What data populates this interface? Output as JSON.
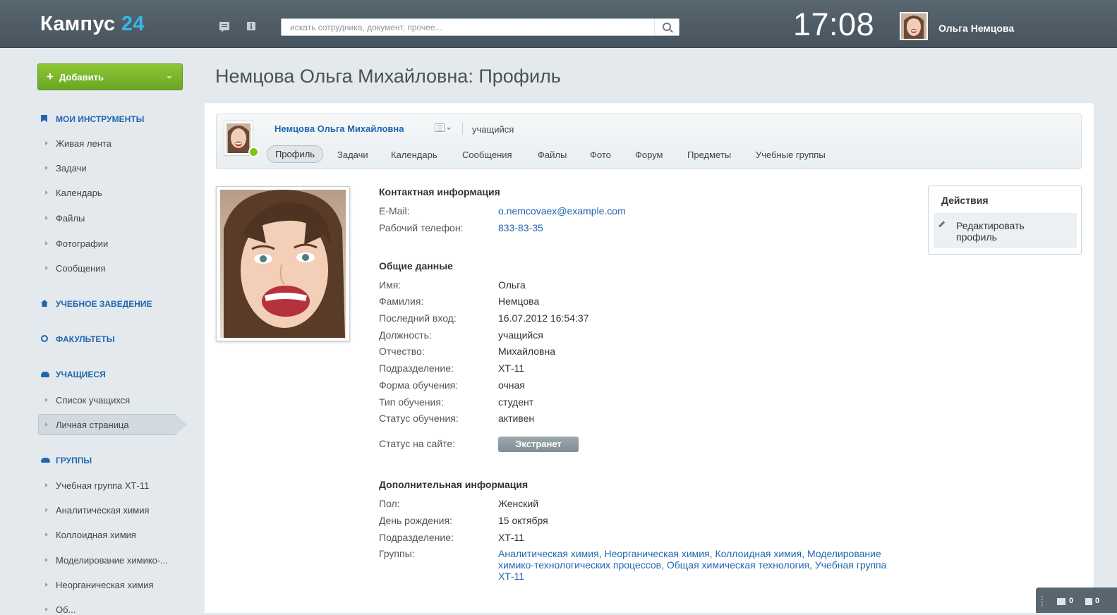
{
  "header": {
    "logo_text": "Кампус",
    "logo_num": "24",
    "search_placeholder": "искать сотрудника, документ, прочее...",
    "clock": "17:08",
    "user_name": "Ольга Немцова"
  },
  "sidebar": {
    "add_button": "Добавить",
    "sections": {
      "tools": "МОИ ИНСТРУМЕНТЫ",
      "school": "УЧЕБНОЕ ЗАВЕДЕНИЕ",
      "faculties": "ФАКУЛЬТЕТЫ",
      "students": "УЧАЩИЕСЯ",
      "groups": "ГРУППЫ"
    },
    "tools_items": [
      "Живая лента",
      "Задачи",
      "Календарь",
      "Файлы",
      "Фотографии",
      "Сообщения"
    ],
    "students_items": [
      "Список учащихся",
      "Личная страница"
    ],
    "groups_items": [
      "Учебная группа ХТ-11",
      "Аналитическая химия",
      "Коллоидная химия",
      "Моделирование химико-...",
      "Неорганическая химия",
      "Об..."
    ]
  },
  "page": {
    "title": "Немцова Ольга Михайловна: Профиль"
  },
  "profile_head": {
    "name": "Немцова Ольга Михайловна",
    "role": "учащийся",
    "tabs": [
      "Профиль",
      "Задачи",
      "Календарь",
      "Сообщения",
      "Файлы",
      "Фото",
      "Форум",
      "Предметы",
      "Учебные группы"
    ]
  },
  "contact": {
    "title": "Контактная информация",
    "email_label": "E-Mail:",
    "email": "o.nemcovaex@example.com",
    "phone_label": "Рабочий телефон:",
    "phone": "833-83-35"
  },
  "general": {
    "title": "Общие данные",
    "rows": [
      {
        "label": "Имя:",
        "value": "Ольга"
      },
      {
        "label": "Фамилия:",
        "value": "Немцова"
      },
      {
        "label": "Последний вход:",
        "value": "16.07.2012 16:54:37"
      },
      {
        "label": "Должность:",
        "value": "учащийся"
      },
      {
        "label": "Отчество:",
        "value": "Михайловна"
      },
      {
        "label": "Подразделение:",
        "value": "ХТ-11"
      },
      {
        "label": "Форма обучения:",
        "value": "очная"
      },
      {
        "label": "Тип обучения:",
        "value": "студент"
      },
      {
        "label": "Статус обучения:",
        "value": "активен"
      }
    ],
    "site_status_label": "Статус на сайте:",
    "site_status": "Экстранет"
  },
  "additional": {
    "title": "Дополнительная информация",
    "rows": [
      {
        "label": "Пол:",
        "value": "Женский"
      },
      {
        "label": "День рождения:",
        "value": "15 октября"
      },
      {
        "label": "Подразделение:",
        "value": "ХТ-11"
      }
    ],
    "groups_label": "Группы:",
    "groups": "Аналитическая химия, Неорганическая химия, Коллоидная химия, Моделирование химико-технологических процессов, Общая химическая технология, Учебная группа ХТ-11"
  },
  "actions": {
    "title": "Действия",
    "edit": "Редактировать профиль"
  },
  "notifications": {
    "messages": "0",
    "info": "0"
  },
  "colors": {
    "accent": "#2067b0",
    "header_bg": "#505d66",
    "add_button": "#7ab52a",
    "online": "#7cc51f",
    "background": "#e3e9ec"
  }
}
